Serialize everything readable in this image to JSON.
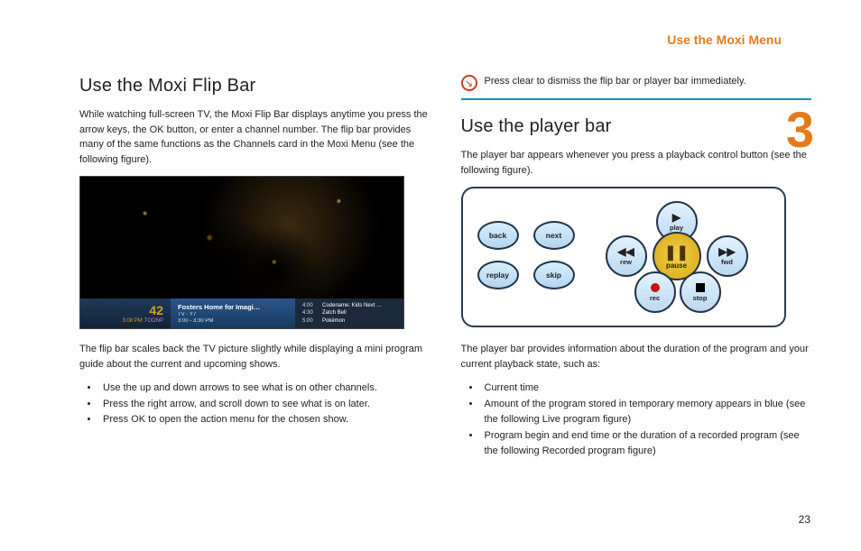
{
  "header": {
    "section_title": "Use the Moxi Menu",
    "chapter_number": "3"
  },
  "page_number": "23",
  "left": {
    "heading": "Use the Moxi Flip Bar",
    "intro": "While watching full-screen TV, the Moxi Flip Bar displays anytime you press the arrow keys, the OK button, or enter a channel number. The flip bar provides many of the same functions as the Channels card in the Moxi Menu (see the following figure).",
    "flip": {
      "channel_number": "42",
      "watch_time": "3:08 PM",
      "network": "TOONP",
      "current_title": "Fosters Home for Imagi…",
      "rating": "TV - Y7",
      "time_range": "3:00 - 3:30 PM",
      "upcoming": [
        {
          "time": "4:00",
          "title": "Codename: Kids Next …"
        },
        {
          "time": "4:30",
          "title": "Zatch Bell"
        },
        {
          "time": "5:00",
          "title": "Pokémon"
        }
      ]
    },
    "after_figure": "The flip bar scales back the TV picture slightly while displaying a mini program guide about the current and upcoming shows.",
    "bullets": [
      "Use the up and down arrows to see what is on other channels.",
      "Press the right arrow, and scroll down to see what is on later.",
      "Press OK to open the action menu for the chosen show."
    ]
  },
  "right": {
    "note": "Press clear to dismiss the flip bar or player bar immediately.",
    "heading": "Use the player bar",
    "intro": "The player bar appears whenever you press a playback control button (see the following figure).",
    "buttons": {
      "back": "back",
      "next": "next",
      "replay": "replay",
      "skip": "skip",
      "play": "play",
      "rew": "rew",
      "fwd": "fwd",
      "pause": "pause",
      "rec": "rec",
      "stop": "stop"
    },
    "after_figure": "The player bar provides information about the duration of the program and your current playback state, such as:",
    "bullets": [
      "Current time",
      "Amount of the program stored in temporary memory appears in blue (see the following Live program figure)",
      "Program begin and end time or the duration of a recorded program (see the following Recorded program figure)"
    ]
  }
}
